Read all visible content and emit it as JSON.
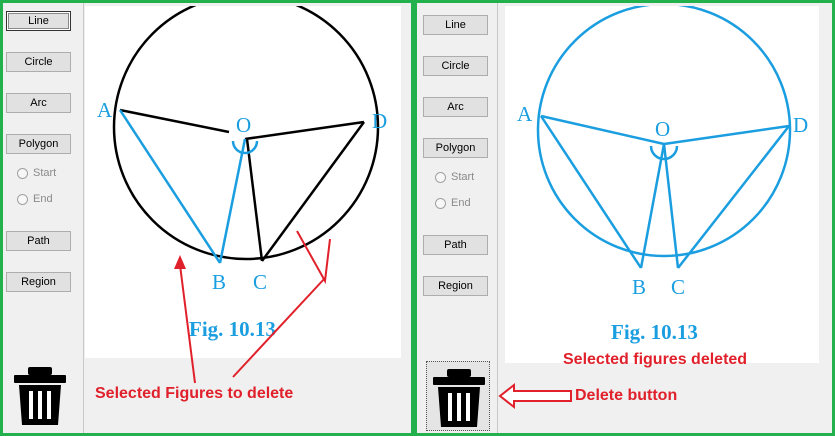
{
  "toolbar": {
    "line": "Line",
    "circle": "Circle",
    "arc": "Arc",
    "polygon": "Polygon",
    "start": "Start",
    "end": "End",
    "path": "Path",
    "region": "Region"
  },
  "figure": {
    "caption": "Fig. 10.13",
    "points": {
      "a": "A",
      "b": "B",
      "c": "C",
      "d": "D",
      "o": "O"
    }
  },
  "annotations": {
    "selected_to_delete": "Selected Figures to delete",
    "selected_deleted": "Selected figures deleted",
    "delete_button": "Delete button"
  },
  "colors": {
    "panel_border": "#22b14c",
    "figure_blue": "#1a9ee0",
    "annotation_red": "#e0202a"
  },
  "icons": [
    "trash-icon"
  ]
}
